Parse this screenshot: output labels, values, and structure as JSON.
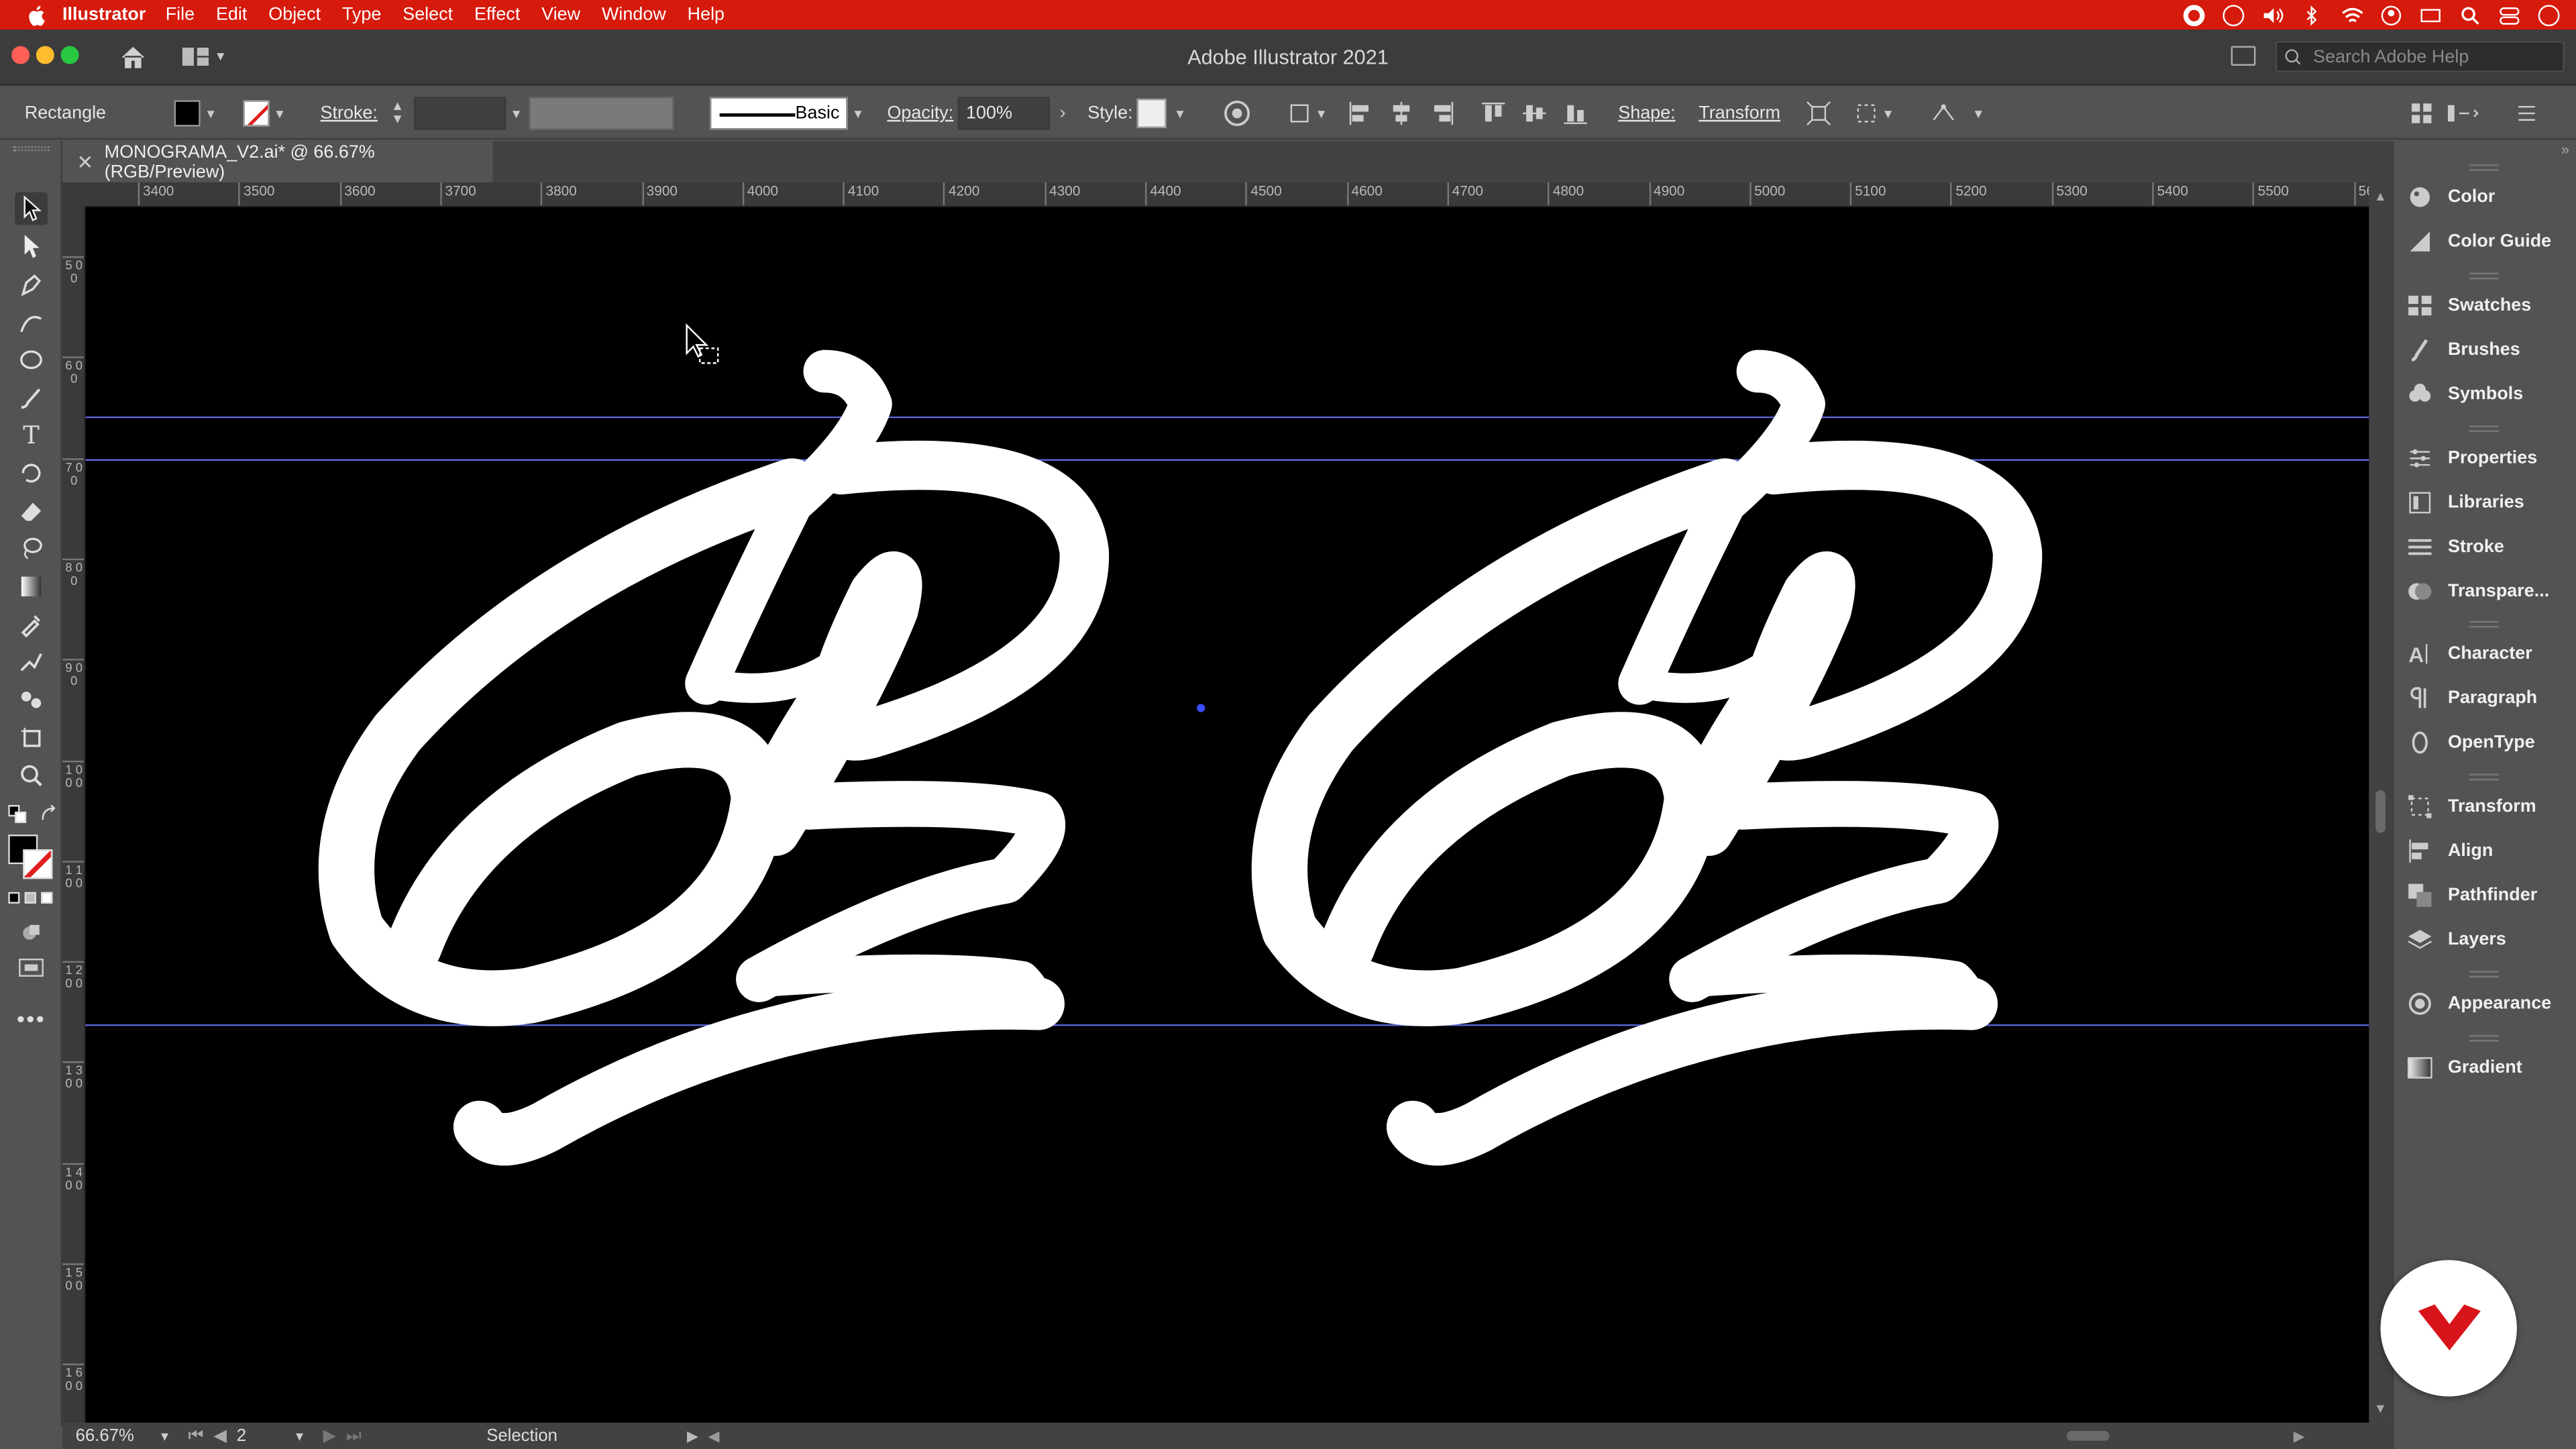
{
  "colors": {
    "menubar": "#d61a0c",
    "canvas_bg": "#000000",
    "artwork": "#ffffff",
    "guide": "#5b67d6",
    "brand_badge": "#d8141b"
  },
  "menubar": {
    "app_name": "Illustrator",
    "items": [
      "File",
      "Edit",
      "Object",
      "Type",
      "Select",
      "Effect",
      "View",
      "Window",
      "Help"
    ]
  },
  "titlebar": {
    "title": "Adobe Illustrator 2021",
    "search_placeholder": "Search Adobe Help"
  },
  "controlbar": {
    "selection_type": "Rectangle",
    "stroke_label": "Stroke:",
    "brush_label": "Basic",
    "opacity_label": "Opacity:",
    "opacity_value": "100%",
    "style_label": "Style:",
    "shape_label": "Shape:",
    "transform_label": "Transform"
  },
  "document": {
    "tab_title": "MONOGRAMA_V2.ai* @ 66.67% (RGB/Preview)"
  },
  "rulers": {
    "horizontal": [
      "3400",
      "3500",
      "3600",
      "3700",
      "3800",
      "3900",
      "4000",
      "4100",
      "4200",
      "4300",
      "4400",
      "4500",
      "4600",
      "4700",
      "4800",
      "4900",
      "5000",
      "5100",
      "5200",
      "5300",
      "5400",
      "5500",
      "56"
    ],
    "vertical": [
      "500",
      "600",
      "700",
      "800",
      "900",
      "1000",
      "1100",
      "1200",
      "1300",
      "1400",
      "1500",
      "1600"
    ]
  },
  "statusbar": {
    "zoom": "66.67%",
    "artboard": "2",
    "tool": "Selection"
  },
  "panels": [
    {
      "label": "Color",
      "icon": "color-palette-icon"
    },
    {
      "label": "Color Guide",
      "icon": "color-guide-icon"
    },
    {
      "label": "Swatches",
      "icon": "swatches-icon"
    },
    {
      "label": "Brushes",
      "icon": "brushes-icon"
    },
    {
      "label": "Symbols",
      "icon": "symbols-icon"
    },
    {
      "label": "Properties",
      "icon": "properties-icon"
    },
    {
      "label": "Libraries",
      "icon": "libraries-icon"
    },
    {
      "label": "Stroke",
      "icon": "stroke-icon"
    },
    {
      "label": "Transpare...",
      "icon": "transparency-icon"
    },
    {
      "label": "Character",
      "icon": "character-icon"
    },
    {
      "label": "Paragraph",
      "icon": "paragraph-icon"
    },
    {
      "label": "OpenType",
      "icon": "opentype-icon"
    },
    {
      "label": "Transform",
      "icon": "transform-icon"
    },
    {
      "label": "Align",
      "icon": "align-icon"
    },
    {
      "label": "Pathfinder",
      "icon": "pathfinder-icon"
    },
    {
      "label": "Layers",
      "icon": "layers-icon"
    },
    {
      "label": "Appearance",
      "icon": "appearance-icon"
    },
    {
      "label": "Gradient",
      "icon": "gradient-icon"
    }
  ]
}
